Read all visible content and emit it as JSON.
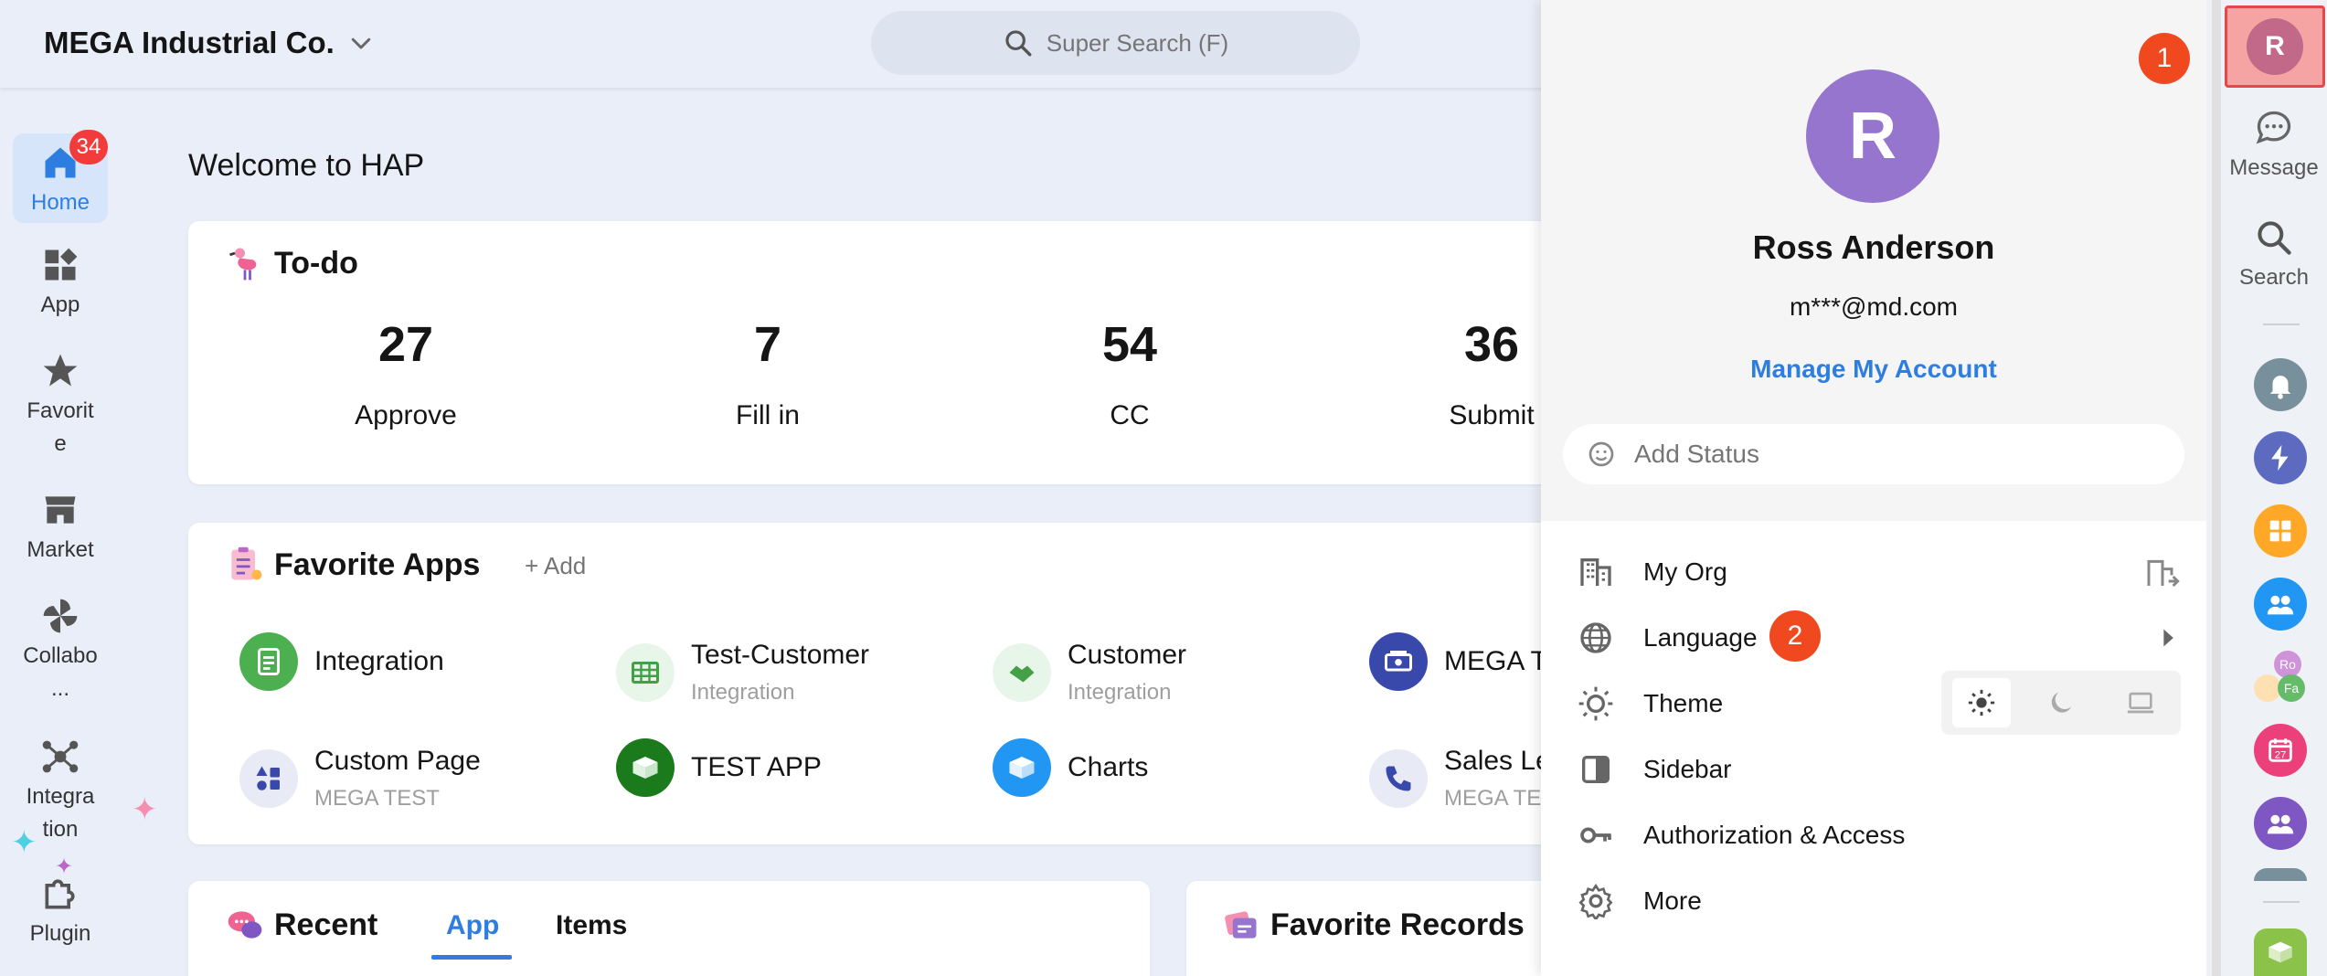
{
  "header": {
    "org_name": "MEGA Industrial Co.",
    "search_placeholder": "Super Search (F)"
  },
  "left_nav": {
    "home": {
      "label": "Home",
      "badge": "34"
    },
    "app": {
      "label": "App"
    },
    "favorite": {
      "label": "Favorit\ne"
    },
    "market": {
      "label": "Market"
    },
    "collabo": {
      "label": "Collabo\n..."
    },
    "integration": {
      "label": "Integra\ntion"
    },
    "plugin": {
      "label": "Plugin"
    }
  },
  "main": {
    "welcome": "Welcome to HAP",
    "todo": {
      "title": "To-do",
      "stats": [
        {
          "value": "27",
          "label": "Approve"
        },
        {
          "value": "7",
          "label": "Fill in"
        },
        {
          "value": "54",
          "label": "CC"
        },
        {
          "value": "36",
          "label": "Submit"
        }
      ]
    },
    "favorite_apps": {
      "title": "Favorite Apps",
      "add_label": "+ Add",
      "apps": [
        {
          "name": "Integration",
          "sub": "",
          "color": "#4caf50"
        },
        {
          "name": "Test-Customer",
          "sub": "Integration",
          "color": "#e8f5e9"
        },
        {
          "name": "Customer",
          "sub": "Integration",
          "color": "#e8f5e9"
        },
        {
          "name": "MEGA T",
          "sub": "",
          "color": "#3949ab"
        },
        {
          "name": "Custom Page",
          "sub": "MEGA TEST",
          "color": "#e8eaf6"
        },
        {
          "name": "TEST APP",
          "sub": "",
          "color": "#1b7a1b"
        },
        {
          "name": "Charts",
          "sub": "",
          "color": "#2196f3"
        },
        {
          "name": "Sales Le",
          "sub": "MEGA TE",
          "color": "#e8eaf6"
        }
      ]
    },
    "recent": {
      "title": "Recent",
      "tabs": [
        "App",
        "Items"
      ]
    },
    "favorite_records": {
      "title": "Favorite Records"
    }
  },
  "profile_panel": {
    "avatar_letter": "R",
    "name": "Ross Anderson",
    "email": "m***@md.com",
    "manage_label": "Manage My Account",
    "status_placeholder": "Add Status",
    "menu": [
      {
        "label": "My Org"
      },
      {
        "label": "Language"
      },
      {
        "label": "Theme"
      },
      {
        "label": "Sidebar"
      },
      {
        "label": "Authorization & Access"
      },
      {
        "label": "More"
      }
    ],
    "markers": [
      "1",
      "2"
    ]
  },
  "right_rail": {
    "avatar_letter": "R",
    "message_label": "Message",
    "search_label": "Search",
    "mini_avatar_1": "Ro",
    "mini_avatar_2": "Fa",
    "calendar_day": "27"
  },
  "colors": {
    "accent": "#2e7de1",
    "badge_red": "#f23c3c",
    "marker_orange": "#f0481f",
    "avatar_purple": "#9575cd"
  }
}
